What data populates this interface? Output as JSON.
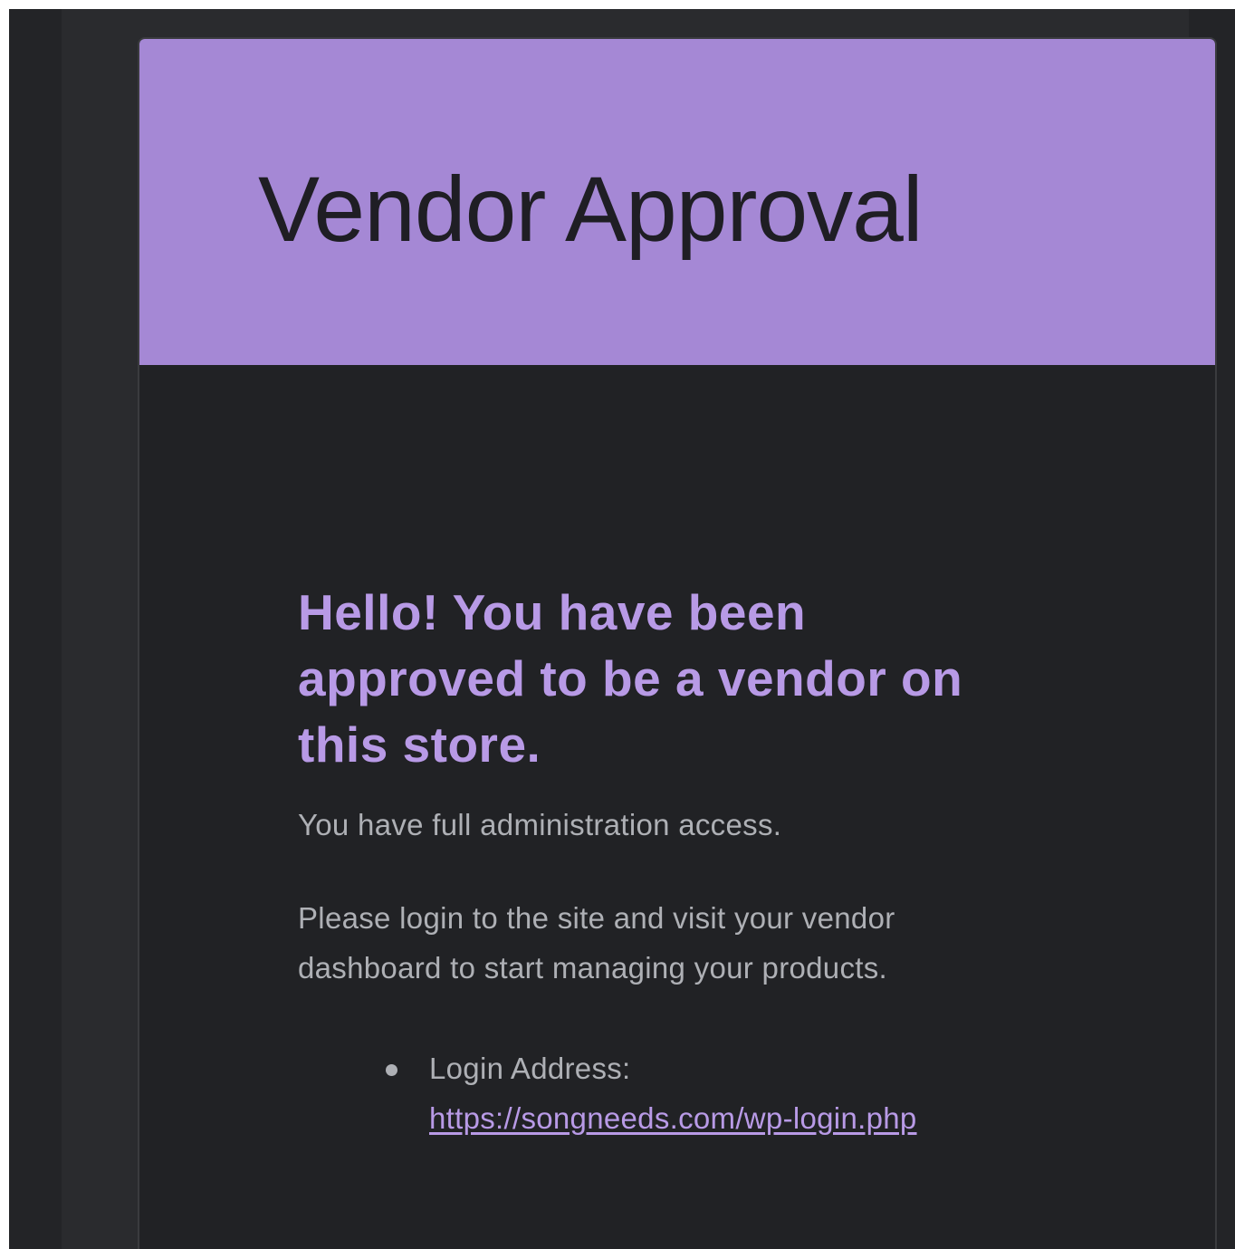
{
  "email": {
    "header": {
      "title": "Vendor Approval",
      "background_color": "#a588d5"
    },
    "body": {
      "greeting": "Hello! You have been approved to be a vendor on this store.",
      "paragraphs": [
        "You have full administration access.",
        "Please login to the site and visit your vendor dashboard to start managing your products."
      ],
      "details": [
        {
          "label": "Login Address:",
          "link_text": "https://songneeds.com/wp-login.php"
        }
      ]
    },
    "colors": {
      "accent": "#b89ae6",
      "page_background": "#232427",
      "card_background": "#212225",
      "body_text": "#aeb0b5"
    }
  }
}
